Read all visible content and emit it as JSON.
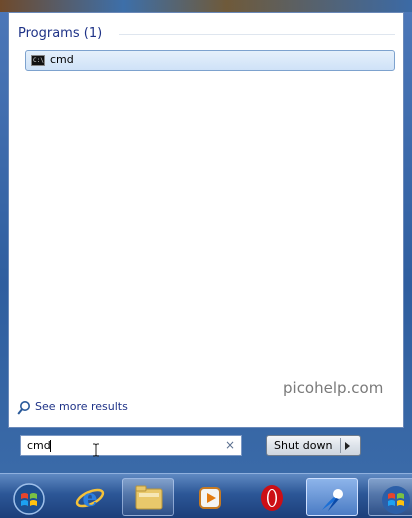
{
  "search_results": {
    "header": "Programs (1)",
    "items": [
      {
        "label": "cmd",
        "icon": "cmd-icon",
        "icon_text": "C:\\"
      }
    ]
  },
  "watermark": "picohelp.com",
  "see_more": {
    "label": "See more results",
    "icon": "search-icon"
  },
  "search_box": {
    "value": "cmd",
    "clear_icon": "×"
  },
  "shutdown": {
    "label": "Shut down",
    "arrow_icon": "chevron-right-icon"
  },
  "taskbar": {
    "items": [
      {
        "name": "start-orb",
        "icon": "windows-logo-icon"
      },
      {
        "name": "internet-explorer",
        "icon": "internet-explorer-icon"
      },
      {
        "name": "windows-explorer",
        "icon": "folder-icon"
      },
      {
        "name": "media-player",
        "icon": "media-player-icon"
      },
      {
        "name": "opera",
        "icon": "opera-icon"
      },
      {
        "name": "search-app",
        "icon": "comet-icon"
      },
      {
        "name": "windows-app",
        "icon": "windows-logo-icon"
      }
    ]
  },
  "colors": {
    "header_text": "#1e3287",
    "selection_fill": "#cfe2f7",
    "taskbar": "#2c5797"
  }
}
